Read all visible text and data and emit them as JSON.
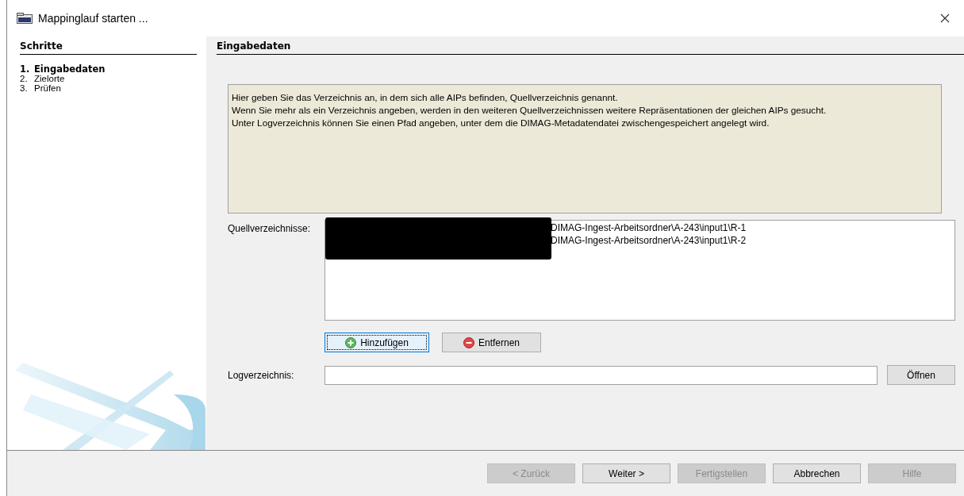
{
  "window": {
    "title": "Mappinglauf starten ..."
  },
  "sidebar": {
    "title": "Schritte",
    "steps": [
      {
        "number": "1.",
        "label": "Eingabedaten",
        "selected": true
      },
      {
        "number": "2.",
        "label": "Zielorte",
        "selected": false
      },
      {
        "number": "3.",
        "label": "Prüfen",
        "selected": false
      }
    ]
  },
  "page": {
    "title": "Eingabedaten",
    "info_lines": [
      "Hier geben Sie das Verzeichnis an, in dem sich alle AIPs befinden, Quellverzeichnis genannt.",
      "Wenn Sie mehr als ein Verzeichnis angeben, werden in den weiteren Quellverzeichnissen weitere Repräsentationen der gleichen AIPs gesucht.",
      "Unter Logverzeichnis können Sie einen Pfad angeben, unter dem die DIMAG-Metadatendatei zwischengespeichert angelegt wird."
    ],
    "source_label": "Quellverzeichnisse:",
    "source_items": [
      "DIMAG-Ingest-Arbeitsordner\\A-243\\input1\\R-1",
      "DIMAG-Ingest-Arbeitsordner\\A-243\\input1\\R-2"
    ],
    "list_buttons": [
      {
        "kind": "add",
        "label": "Hinzufügen",
        "focused": true
      },
      {
        "kind": "remove",
        "label": "Entfernen",
        "focused": false
      }
    ],
    "log_label": "Logverzeichnis:",
    "open_button": "Öffnen"
  },
  "footer_buttons": [
    {
      "label": "< Zurück",
      "disabled": true
    },
    {
      "label": "Weiter >",
      "disabled": false
    },
    {
      "label": "Fertigstellen",
      "disabled": true
    },
    {
      "label": "Abbrechen",
      "disabled": false
    },
    {
      "label": "Hilfe",
      "disabled": true
    }
  ]
}
